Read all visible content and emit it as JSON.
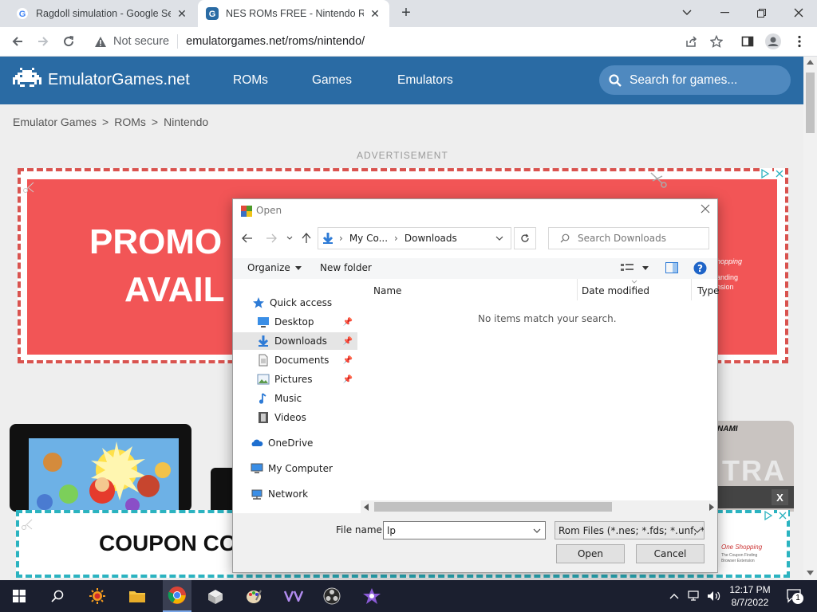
{
  "browser": {
    "tabs": [
      {
        "title": "Ragdoll simulation - Google Search",
        "close": "✕"
      },
      {
        "title": "NES ROMs FREE - Nintendo ROMs",
        "close": "✕"
      }
    ],
    "new_tab": "+",
    "security": "Not secure",
    "url": "emulatorgames.net/roms/nintendo/"
  },
  "site": {
    "logo_text": "EmulatorGames.net",
    "nav": [
      "ROMs",
      "Games",
      "Emulators"
    ],
    "search_placeholder": "Search for games...",
    "breadcrumb": [
      "Emulator Games",
      ">",
      "ROMs",
      ">",
      "Nintendo"
    ],
    "ad_label": "ADVERTISEMENT",
    "ad1_text_line1": "PROMO",
    "ad1_text_line2": "AVAIL",
    "ad1_side_lines": [
      "hopping",
      "anding",
      "nsion"
    ],
    "ad2_text": "COUPON CO",
    "ad2_side_lines": [
      "One Shopping",
      "The Coupon Finding",
      "Browser Extension"
    ],
    "close_x": "X",
    "game_right_label": "NAMI",
    "game_right_text": "TRA"
  },
  "dialog": {
    "title": "Open",
    "path": [
      "My Co...",
      "Downloads"
    ],
    "search_placeholder": "Search Downloads",
    "organize": "Organize",
    "new_folder": "New folder",
    "columns": [
      "Name",
      "Date modified",
      "Type"
    ],
    "empty_message": "No items match your search.",
    "tree": {
      "quick_access": "Quick access",
      "items": [
        "Desktop",
        "Downloads",
        "Documents",
        "Pictures",
        "Music",
        "Videos"
      ],
      "onedrive": "OneDrive",
      "computer": "My Computer",
      "network": "Network"
    },
    "file_name_label": "File name:",
    "file_name_value": "lp",
    "file_type": "Rom Files (*.nes; *.fds; *.unf; *.s",
    "open_button": "Open",
    "cancel_button": "Cancel"
  },
  "taskbar": {
    "time": "12:17 PM",
    "date": "8/7/2022",
    "notif_count": "1"
  },
  "colors": {
    "site_header": "#2a6ba4",
    "ad_red": "#f25556",
    "ad_dash": "#d9534f",
    "ad2_dash": "#2bb3c0"
  }
}
